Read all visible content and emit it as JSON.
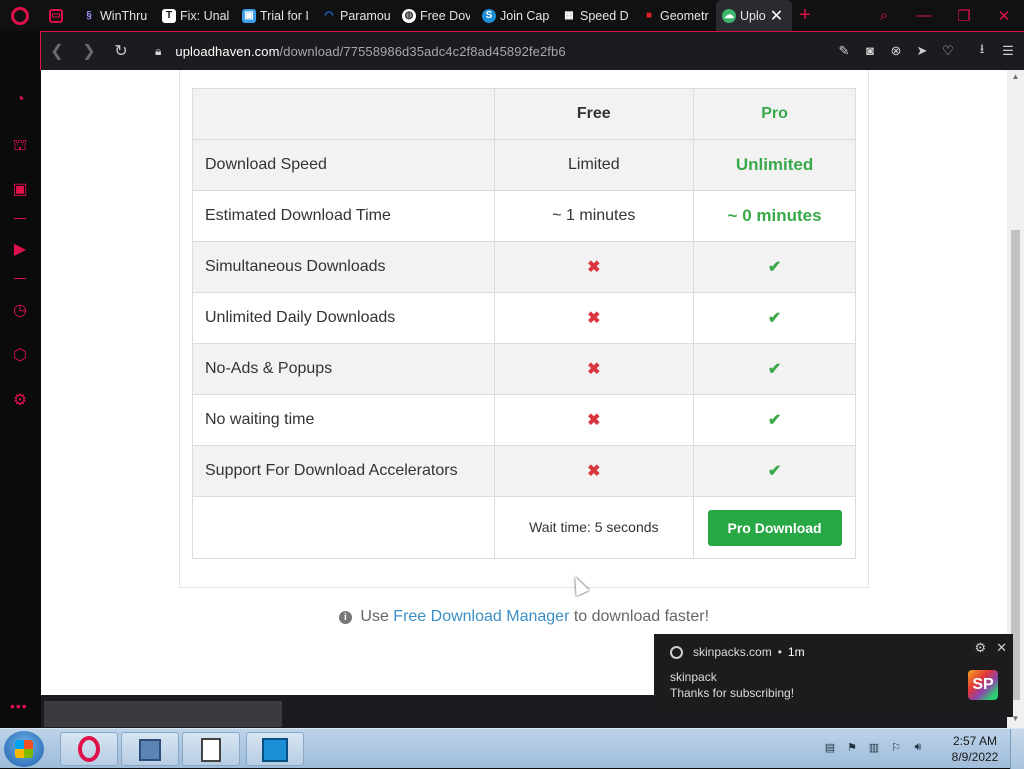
{
  "browser": {
    "tabs": [
      {
        "label": "",
        "icon": "gamepad-icon",
        "color": "#e0114a"
      },
      {
        "label": "WinThru",
        "icon": "winthru-icon",
        "color": "#9b9bff"
      },
      {
        "label": "Fix: Unal",
        "icon": "it-icon",
        "color": "#ffffff"
      },
      {
        "label": "Trial for I",
        "icon": "trial-icon",
        "color": "#3ba0e8"
      },
      {
        "label": "Paramou",
        "icon": "paramount-icon",
        "color": "#1f7cf2"
      },
      {
        "label": "Free Dov",
        "icon": "globe-icon",
        "color": "#ffffff"
      },
      {
        "label": "Join Cap",
        "icon": "s-icon",
        "color": "#1d8fd6"
      },
      {
        "label": "Speed D",
        "icon": "grid-icon",
        "color": "#ffffff"
      },
      {
        "label": "Geometr",
        "icon": "lock-icon",
        "color": "#e02020"
      }
    ],
    "active_tab": {
      "label": "Uplo",
      "icon": "cloud-icon",
      "color": "#3ab56a"
    },
    "url_host": "uploadhaven.com",
    "url_path": "/download/77558986d35adc4c2f8ad45892fe2fb6"
  },
  "comparison": {
    "headers": {
      "feature": "",
      "free": "Free",
      "pro": "Pro"
    },
    "rows": [
      {
        "feature": "Download Speed",
        "free": "Limited",
        "pro": "Unlimited",
        "type": "text"
      },
      {
        "feature": "Estimated Download Time",
        "free": "~ 1 minutes",
        "pro": "~ 0 minutes",
        "type": "text"
      },
      {
        "feature": "Simultaneous Downloads",
        "free": "✖",
        "pro": "✔",
        "type": "icon"
      },
      {
        "feature": "Unlimited Daily Downloads",
        "free": "✖",
        "pro": "✔",
        "type": "icon"
      },
      {
        "feature": "No-Ads & Popups",
        "free": "✖",
        "pro": "✔",
        "type": "icon"
      },
      {
        "feature": "No waiting time",
        "free": "✖",
        "pro": "✔",
        "type": "icon"
      },
      {
        "feature": "Support For Download Accelerators",
        "free": "✖",
        "pro": "✔",
        "type": "icon"
      }
    ],
    "wait_text": "Wait time: 5 seconds",
    "pro_button": "Pro Download"
  },
  "fdm": {
    "prefix": "Use",
    "link": "Free Download Manager",
    "suffix": "to download faster!"
  },
  "notification": {
    "source": "skinpacks.com",
    "separator": "•",
    "age": "1m",
    "title": "skinpack",
    "body": "Thanks for subscribing!",
    "badge": "SP"
  },
  "taskbar": {
    "time": "2:57 AM",
    "date": "8/9/2022"
  },
  "colors": {
    "opera_red": "#e0114a",
    "pro_green": "#3aa94a",
    "x_red": "#d9363e",
    "link_blue": "#3b8fc6"
  }
}
